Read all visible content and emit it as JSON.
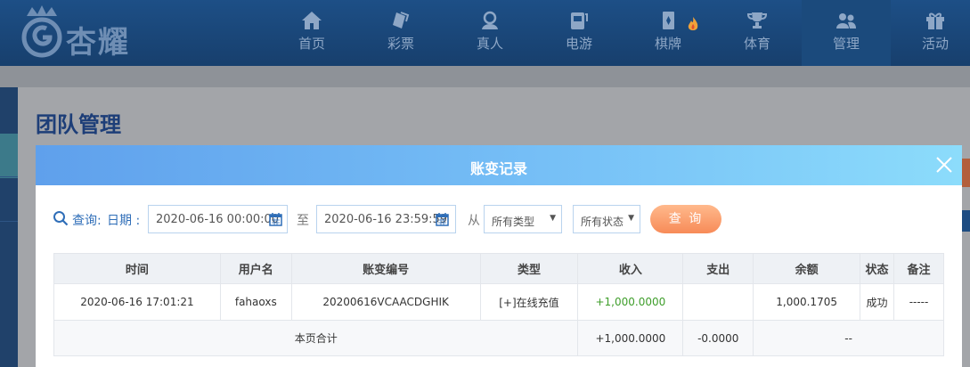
{
  "brand": {
    "logo_text": "杏耀"
  },
  "nav": [
    {
      "label": "首页",
      "icon": "home-icon"
    },
    {
      "label": "彩票",
      "icon": "lottery-icon"
    },
    {
      "label": "真人",
      "icon": "live-dealer-icon"
    },
    {
      "label": "电游",
      "icon": "slot-machine-icon"
    },
    {
      "label": "棋牌",
      "icon": "cards-icon",
      "badge": "flame-icon"
    },
    {
      "label": "体育",
      "icon": "trophy-icon"
    },
    {
      "label": "管理",
      "icon": "users-icon"
    },
    {
      "label": "活动",
      "icon": "gift-icon"
    }
  ],
  "page": {
    "title": "团队管理"
  },
  "modal": {
    "title": "账变记录",
    "filters": {
      "query_label": "查询:",
      "date_label": "日期 :",
      "start_date": "2020-06-16 00:00:00",
      "to_label": "至",
      "end_date": "2020-06-16 23:59:59",
      "from_label": "从",
      "type_select": "所有类型",
      "status_select": "所有状态",
      "query_button": "查 询"
    },
    "table": {
      "columns": [
        "时间",
        "用户名",
        "账变编号",
        "类型",
        "收入",
        "支出",
        "余额",
        "状态",
        "备注"
      ],
      "rows": [
        {
          "time": "2020-06-16 17:01:21",
          "username": "fahaoxs",
          "txn_id": "20200616VCAACDGHIK",
          "type": "[+]在线充值",
          "income": "+1,000.0000",
          "expense": "",
          "balance": "1,000.1705",
          "status": "成功",
          "remark": "-----"
        }
      ],
      "total": {
        "label": "本页合计",
        "income": "+1,000.0000",
        "expense": "-0.0000",
        "rest": "--"
      }
    }
  },
  "colors": {
    "nav_bg": "#1d4f86",
    "title_blue": "#1d3e78",
    "modal_header_start": "#5fa0ec",
    "modal_header_end": "#8cdcfb",
    "query_button": "#f78b58",
    "income_green": "#3f9e2b"
  }
}
